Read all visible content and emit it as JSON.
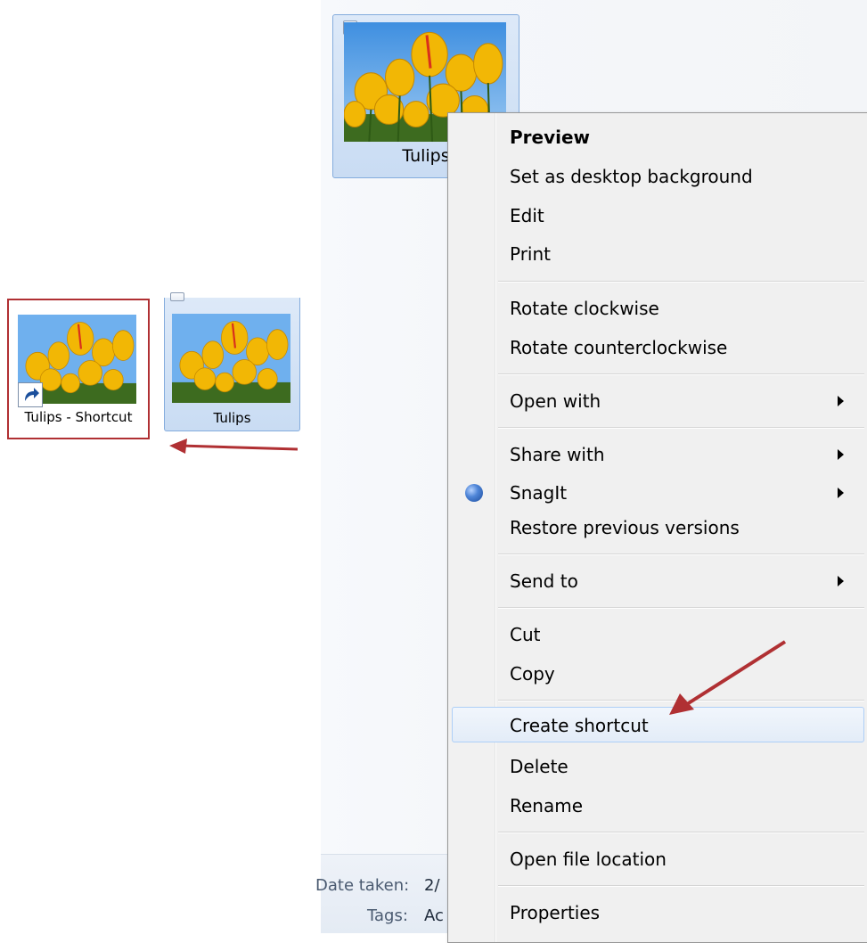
{
  "left_view": {
    "shortcut_item": {
      "label": "Tulips - Shortcut"
    },
    "original_item": {
      "label": "Tulips"
    }
  },
  "explorer": {
    "selected_item": {
      "label": "Tulips",
      "checked_mark": "✓"
    },
    "details": {
      "date_taken_label": "Date taken:",
      "date_taken_value": "2/",
      "tags_label": "Tags:",
      "tags_value": "Ac"
    }
  },
  "context_menu": {
    "items": [
      {
        "label": "Preview",
        "bold": true
      },
      {
        "label": "Set as desktop background"
      },
      {
        "label": "Edit"
      },
      {
        "label": "Print"
      },
      {
        "label": "Rotate clockwise"
      },
      {
        "label": "Rotate counterclockwise"
      },
      {
        "label": "Open with",
        "submenu": true
      },
      {
        "label": "Share with",
        "submenu": true
      },
      {
        "label": "SnagIt",
        "submenu": true,
        "icon": "snagit-globe-icon"
      },
      {
        "label": "Restore previous versions"
      },
      {
        "label": "Send to",
        "submenu": true
      },
      {
        "label": "Cut"
      },
      {
        "label": "Copy"
      },
      {
        "label": "Create shortcut",
        "highlighted": true
      },
      {
        "label": "Delete"
      },
      {
        "label": "Rename"
      },
      {
        "label": "Open file location"
      },
      {
        "label": "Properties"
      }
    ]
  },
  "colors": {
    "annotation_red": "#b03033",
    "selection_blue": "#84acdd",
    "menu_background": "#f0f0f0"
  }
}
